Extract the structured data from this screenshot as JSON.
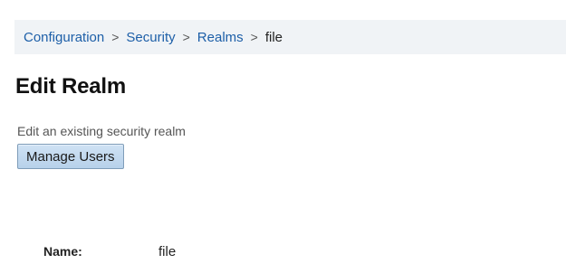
{
  "breadcrumb": {
    "items": [
      {
        "label": "Configuration"
      },
      {
        "label": "Security"
      },
      {
        "label": "Realms"
      }
    ],
    "separator": ">",
    "current": "file"
  },
  "header": {
    "title": "Edit Realm",
    "subtitle": "Edit an existing security realm"
  },
  "toolbar": {
    "manage_users_label": "Manage Users"
  },
  "form": {
    "name_label": "Name:",
    "name_value": "file"
  },
  "colors": {
    "breadcrumb_bg": "#f0f3f6",
    "link": "#1d5fa8",
    "button_bg": "#b7d1ea",
    "button_border": "#7f9db9"
  }
}
